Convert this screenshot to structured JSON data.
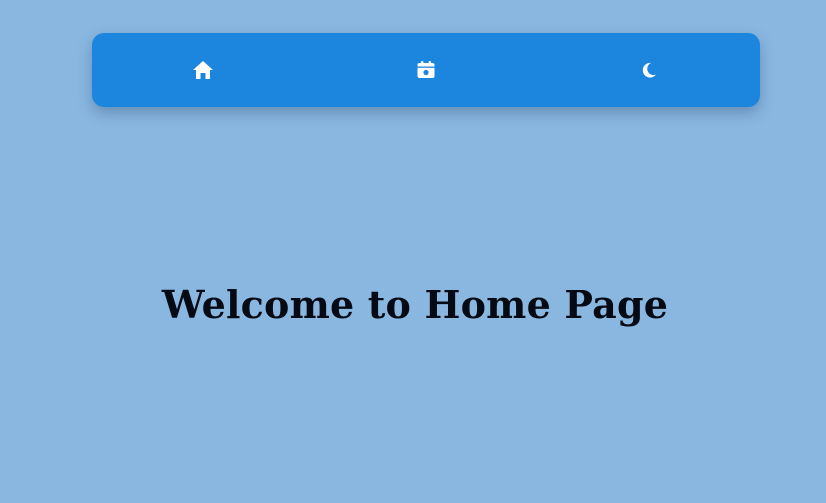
{
  "navbar": {
    "items": [
      {
        "id": "home",
        "icon": "home-icon"
      },
      {
        "id": "calendar",
        "icon": "calendar-icon"
      },
      {
        "id": "theme",
        "icon": "moon-icon"
      }
    ],
    "background_color": "#1c86df",
    "icon_color": "#ffffff"
  },
  "main": {
    "heading": "Welcome to Home Page"
  },
  "page": {
    "background_color": "#89b7e0"
  }
}
